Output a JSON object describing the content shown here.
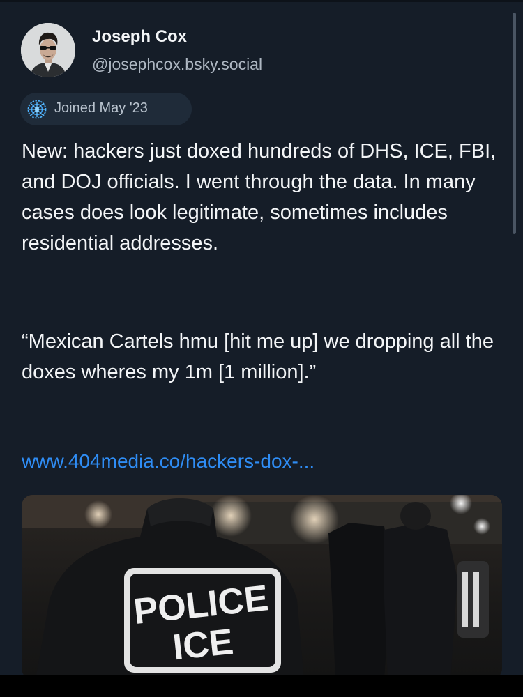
{
  "author": {
    "name": "Joseph Cox",
    "handle": "@josephcox.bsky.social",
    "avatar_icon": "user-photo-avatar"
  },
  "badge": {
    "label": "Joined May '23",
    "icon": "starburst-icon"
  },
  "post": {
    "text": "New: hackers just doxed hundreds of DHS, ICE, FBI, and DOJ officials. I went through the data. In many cases does look legitimate, sometimes includes residential addresses.",
    "quote": "“Mexican Cartels hmu [hit me up] we dropping all the doxes wheres my 1m [1 million].”",
    "link": "www.404media.co/hackers-dox-..."
  },
  "embed": {
    "patch_line1": "POLICE",
    "patch_line2": "ICE"
  },
  "colors": {
    "background": "#151d28",
    "text": "#f3f5f7",
    "secondary_text": "#aeb7c2",
    "link": "#2f8df5",
    "badge_bg": "#1f2b39"
  }
}
